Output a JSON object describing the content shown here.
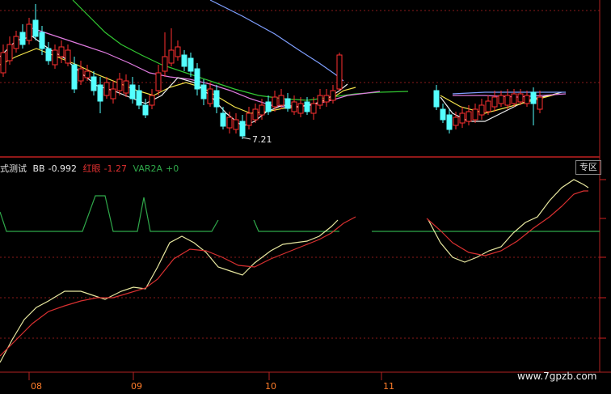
{
  "chart_data": {
    "type": "line",
    "indicator": {
      "name": "式测试",
      "series": [
        {
          "name": "BB",
          "value": "-0.992",
          "color": "#e8e8a0"
        },
        {
          "name": "红眼",
          "value": "-1.27",
          "color": "#d83030"
        },
        {
          "name": "VAR2A",
          "value": "+0",
          "color": "#2fa84a"
        }
      ]
    },
    "low_label": "7.21",
    "x_axis_labels": [
      "08",
      "09",
      "10",
      "11"
    ],
    "tag": "专区"
  },
  "colors": {
    "up": "#ff3030",
    "down": "#54ffff",
    "grid": "#9b1c1c",
    "axis": "#b22222",
    "ma1": "#f0f0f0",
    "ma2": "#f2e24a",
    "ma3": "#e87be8",
    "ma4": "#32c832",
    "ma5": "#8aa8ff"
  },
  "watermark": "www.7gpzb.com"
}
